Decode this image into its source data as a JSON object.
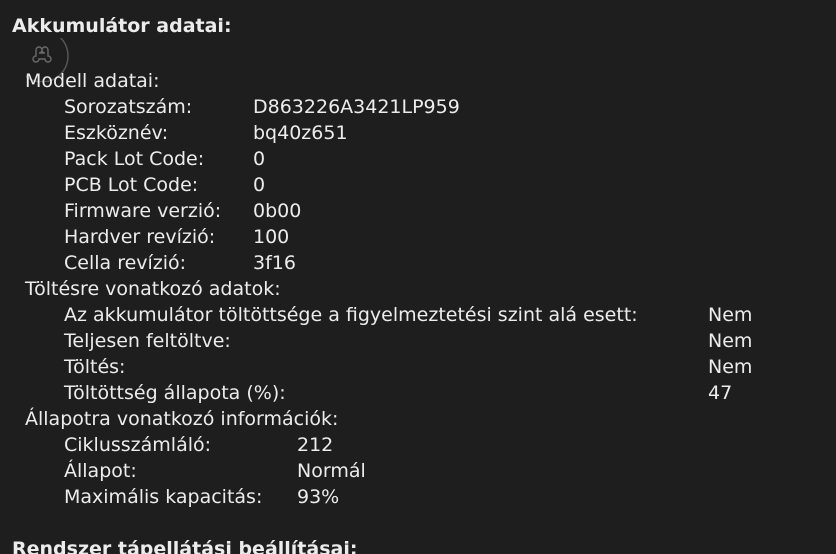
{
  "section1_title": "Akkumulátor adatai:",
  "model": {
    "heading": "Modell adatai:",
    "rows": [
      {
        "label": "Sorozatszám:",
        "value": "D863226A3421LP959"
      },
      {
        "label": "Eszköznév:",
        "value": "bq40z651"
      },
      {
        "label": "Pack Lot Code:",
        "value": "0"
      },
      {
        "label": "PCB Lot Code:",
        "value": "0"
      },
      {
        "label": "Firmware verzió:",
        "value": "0b00"
      },
      {
        "label": "Hardver revízió:",
        "value": "100"
      },
      {
        "label": "Cella revízió:",
        "value": "3f16"
      }
    ]
  },
  "charge": {
    "heading": "Töltésre vonatkozó adatok:",
    "rows": [
      {
        "label": "Az akkumulátor töltöttsége a figyelmeztetési szint alá esett:",
        "value": "Nem"
      },
      {
        "label": "Teljesen feltöltve:",
        "value": "Nem"
      },
      {
        "label": "Töltés:",
        "value": "Nem"
      },
      {
        "label": "Töltöttség állapota (%):",
        "value": "47"
      }
    ]
  },
  "health": {
    "heading": "Állapotra vonatkozó információk:",
    "rows": [
      {
        "label": "Ciklusszámláló:",
        "value": "212"
      },
      {
        "label": "Állapot:",
        "value": "Normál"
      },
      {
        "label": "Maximális kapacitás:",
        "value": "93%"
      }
    ]
  },
  "section2_title": "Rendszer tápellátási beállításai:",
  "icons": {
    "cursor": "command-key-cursor-icon"
  },
  "colors": {
    "background": "#1e1e1e",
    "text": "#ececec"
  }
}
